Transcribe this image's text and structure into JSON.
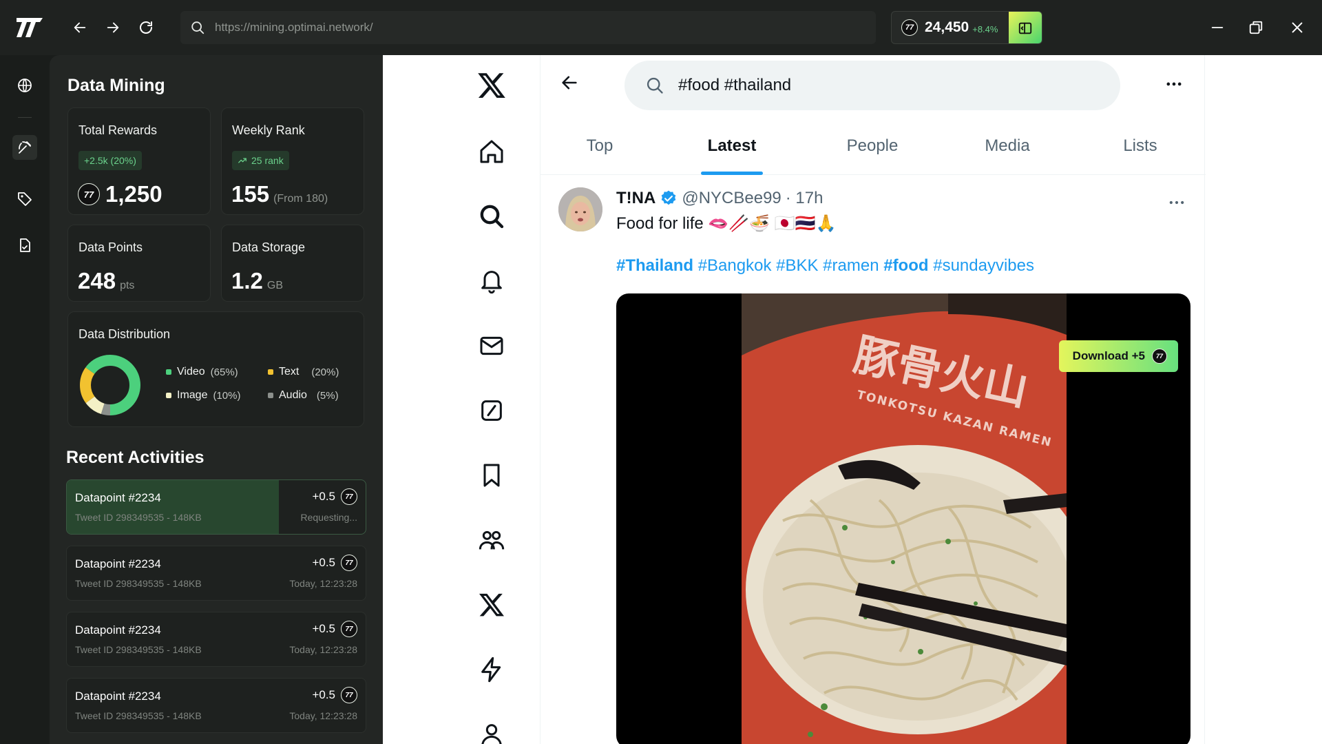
{
  "browser": {
    "url": "https://mining.optimai.network/",
    "balance": "24,450",
    "balance_change": "+8.4%",
    "coin_symbol": "77"
  },
  "mining": {
    "title": "Data Mining",
    "total_rewards": {
      "label": "Total Rewards",
      "badge": "+2.5k (20%)",
      "value": "1,250"
    },
    "weekly_rank": {
      "label": "Weekly Rank",
      "badge": "25 rank",
      "value": "155",
      "sub": "(From 180)"
    },
    "data_points": {
      "label": "Data Points",
      "value": "248",
      "unit": "pts"
    },
    "data_storage": {
      "label": "Data Storage",
      "value": "1.2",
      "unit": "GB"
    },
    "distribution": {
      "label": "Data Distribution",
      "items": [
        {
          "name": "Video",
          "pct": "(65%)",
          "value": 65,
          "color": "#4cd07d"
        },
        {
          "name": "Text",
          "pct": "(20%)",
          "value": 20,
          "color": "#f2c230"
        },
        {
          "name": "Image",
          "pct": "(10%)",
          "value": 10,
          "color": "#f4f1c6"
        },
        {
          "name": "Audio",
          "pct": "(5%)",
          "value": 5,
          "color": "#8c908c"
        }
      ]
    },
    "recent": {
      "title": "Recent Activities",
      "items": [
        {
          "title": "Datapoint #2234",
          "sub": "Tweet ID 298349535 - 148KB",
          "reward": "+0.5",
          "time": "Requesting...",
          "progress": 0.71
        },
        {
          "title": "Datapoint #2234",
          "sub": "Tweet ID 298349535 - 148KB",
          "reward": "+0.5",
          "time": "Today, 12:23:28"
        },
        {
          "title": "Datapoint #2234",
          "sub": "Tweet ID 298349535 - 148KB",
          "reward": "+0.5",
          "time": "Today, 12:23:28"
        },
        {
          "title": "Datapoint #2234",
          "sub": "Tweet ID 298349535 - 148KB",
          "reward": "+0.5",
          "time": "Today, 12:23:28"
        }
      ]
    }
  },
  "x": {
    "search_query": "#food #thailand",
    "tabs": [
      "Top",
      "Latest",
      "People",
      "Media",
      "Lists"
    ],
    "active_tab": "Latest",
    "tweet": {
      "name": "T!NA",
      "handle": "@NYCBee99",
      "time": "· 17h",
      "text": "Food for life 🫦🥢🍜 🇯🇵🇹🇭🙏",
      "tags": [
        {
          "text": "#Thailand",
          "bold": true
        },
        {
          "text": "#Bangkok",
          "bold": false
        },
        {
          "text": "#BKK",
          "bold": false
        },
        {
          "text": "#ramen",
          "bold": false
        },
        {
          "text": "#food",
          "bold": true
        },
        {
          "text": "#sundayvibes",
          "bold": false
        }
      ],
      "bowl_text_1": "豚骨火山",
      "bowl_text_2": "TONKOTSU KAZAN RAMEN",
      "download_label": "Download +5"
    }
  }
}
